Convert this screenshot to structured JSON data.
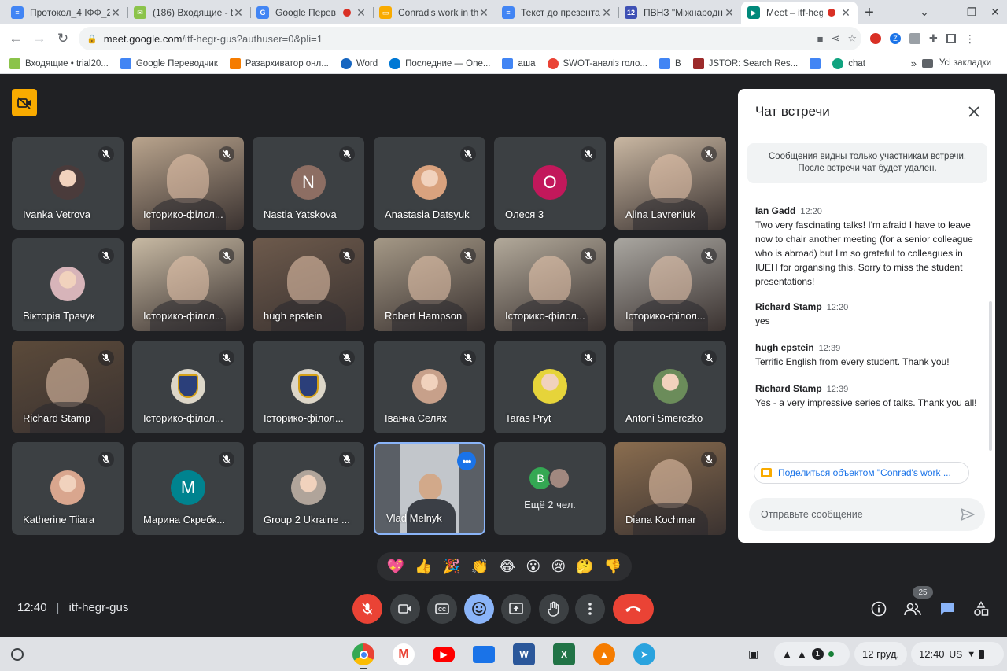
{
  "browser": {
    "tabs": [
      {
        "title": "Протокол_4 ІФФ_2",
        "favicon_color": "#4285f4",
        "active": false,
        "recording": false
      },
      {
        "title": "(186) Входящие - t",
        "favicon_color": "#8bc34a",
        "active": false,
        "recording": false
      },
      {
        "title": "Google Перев",
        "favicon_color": "#4285f4",
        "active": false,
        "recording": true
      },
      {
        "title": "Conrad's work in th",
        "favicon_color": "#f9ab00",
        "active": false,
        "recording": false
      },
      {
        "title": "Текст до презента",
        "favicon_color": "#4285f4",
        "active": false,
        "recording": false
      },
      {
        "title": "ПВНЗ \"Міжнародн",
        "favicon_color": "#3f51b5",
        "active": false,
        "recording": false
      },
      {
        "title": "Meet – itf-heg",
        "favicon_color": "#00897b",
        "active": true,
        "recording": true
      }
    ],
    "url_host": "meet.google.com",
    "url_rest": "/itf-hegr-gus?authuser=0&pli=1",
    "bookmarks": [
      {
        "label": "Входящие • trial20...",
        "color": "#8bc34a"
      },
      {
        "label": "Google Переводчик",
        "color": "#4285f4"
      },
      {
        "label": "Разархиватор онл...",
        "color": "#f57c00"
      },
      {
        "label": "Word",
        "color": "#1565c0"
      },
      {
        "label": "Последние — One...",
        "color": "#0078d4"
      },
      {
        "label": "аша",
        "color": "#4285f4"
      },
      {
        "label": "SWOT-аналіз голо...",
        "color": "#ea4335"
      },
      {
        "label": "В",
        "color": "#4285f4"
      },
      {
        "label": "JSTOR: Search Res...",
        "color": "#9c2a2a"
      },
      {
        "label": "",
        "color": "#4285f4"
      },
      {
        "label": "chat",
        "color": "#10a37f"
      }
    ],
    "bookmarks_more": "»",
    "all_bookmarks": "Усі закладки"
  },
  "meet": {
    "meeting_code": "itf-hegr-gus",
    "clock": "12:40",
    "participant_count": "25",
    "tiles": [
      {
        "name": "Ivanka Vetrova",
        "kind": "avatar-photo",
        "color": "#4a3b3b"
      },
      {
        "name": "Історико-філол...",
        "kind": "video",
        "color": "#b9a48d"
      },
      {
        "name": "Nastia Yatskova",
        "kind": "letter",
        "letter": "N",
        "color": "#8d6e63"
      },
      {
        "name": "Anastasia Datsyuk",
        "kind": "avatar-photo",
        "color": "#d9a27e"
      },
      {
        "name": "Олеся 3",
        "kind": "letter",
        "letter": "О",
        "color": "#c2185b"
      },
      {
        "name": "Alina Lavreniuk",
        "kind": "video",
        "color": "#c9b7a2"
      },
      {
        "name": "Вікторія Трачук",
        "kind": "avatar-photo",
        "color": "#d7b4b9"
      },
      {
        "name": "Історико-філол...",
        "kind": "video",
        "color": "#c7b9a3"
      },
      {
        "name": "hugh epstein",
        "kind": "video",
        "color": "#6d5a4c"
      },
      {
        "name": "Robert Hampson",
        "kind": "video",
        "color": "#a49886"
      },
      {
        "name": "Історико-філол...",
        "kind": "video",
        "color": "#b2a99a"
      },
      {
        "name": "Історико-філол...",
        "kind": "video",
        "color": "#a9a6a0"
      },
      {
        "name": "Richard Stamp",
        "kind": "video",
        "color": "#5b4a3a"
      },
      {
        "name": "Історико-філол...",
        "kind": "avatar-emblem",
        "color": "#2b3f7a"
      },
      {
        "name": "Історико-філол...",
        "kind": "avatar-emblem",
        "color": "#2b3f7a"
      },
      {
        "name": "Іванка Селях",
        "kind": "avatar-photo",
        "color": "#c7a08a"
      },
      {
        "name": "Taras Pryt",
        "kind": "avatar-photo",
        "color": "#e6d43a"
      },
      {
        "name": "Antoni Smerczko",
        "kind": "avatar-photo",
        "color": "#6b8c5a"
      },
      {
        "name": "Katherine Tiiara",
        "kind": "avatar-photo",
        "color": "#d9a68e"
      },
      {
        "name": "Марина Скребк...",
        "kind": "letter",
        "letter": "M",
        "color": "#00838f"
      },
      {
        "name": "Group 2 Ukraine ...",
        "kind": "avatar-photo",
        "color": "#b0a49a"
      },
      {
        "name": "Vlad Melnyk",
        "kind": "self-video",
        "color": "#c2c6cb"
      },
      {
        "name": "",
        "kind": "others",
        "label": "Ещё 2 чел.",
        "letter": "B"
      },
      {
        "name": "Diana Kochmar",
        "kind": "video",
        "color": "#8a6d4f"
      }
    ],
    "reactions": [
      "💖",
      "👍",
      "🎉",
      "👏",
      "😂",
      "😮",
      "😢",
      "🤔",
      "👎"
    ]
  },
  "chat": {
    "title": "Чат встречи",
    "notice_line1": "Сообщения видны только участникам встречи.",
    "notice_line2": "После встречи чат будет удален.",
    "messages": [
      {
        "author": "Ian Gadd",
        "time": "12:20",
        "text": "Two very fascinating talks! I'm afraid I have to leave now to chair another meeting (for a senior colleague who is abroad) but I'm so grateful to colleagues in IUEH for organsing this. Sorry to miss the student presentations!"
      },
      {
        "author": "Richard Stamp",
        "time": "12:20",
        "text": "yes"
      },
      {
        "author": "hugh epstein",
        "time": "12:39",
        "text": "Terrific English from every student. Thank you!"
      },
      {
        "author": "Richard Stamp",
        "time": "12:39",
        "text": "Yes - a very impressive series of talks. Thank you all!"
      }
    ],
    "share_chip": "Поделиться объектом \"Conrad's work ...",
    "compose_placeholder": "Отправьте сообщение"
  },
  "shelf": {
    "date": "12 груд.",
    "time": "12:40",
    "locale": "US",
    "notification_count": "1"
  }
}
